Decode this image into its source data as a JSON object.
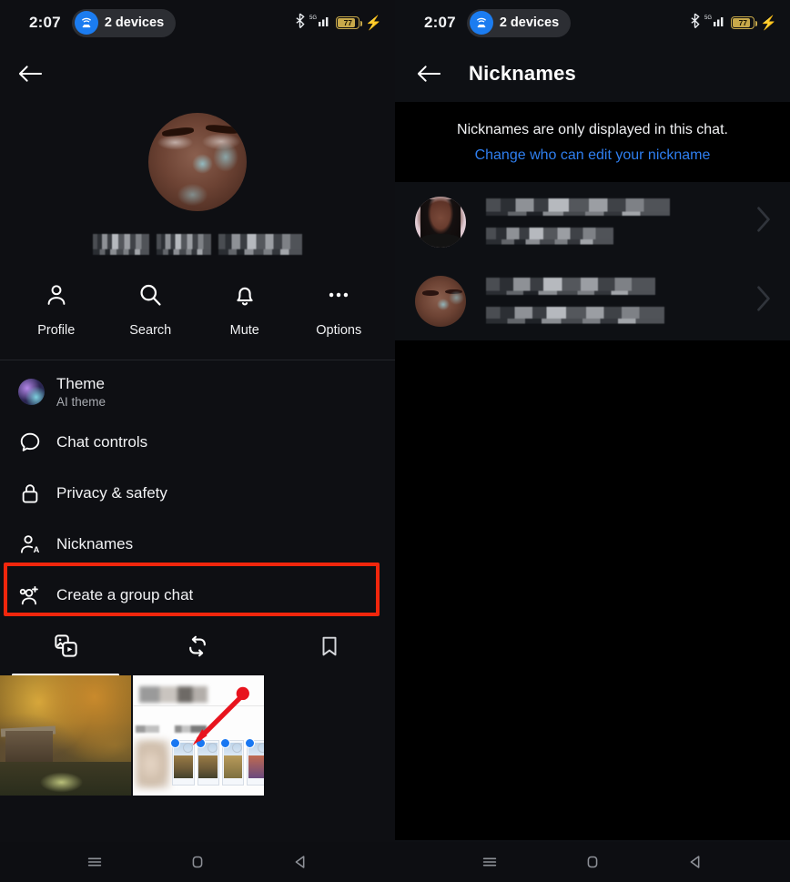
{
  "status_bar": {
    "time": "2:07",
    "devices_pill": {
      "label": "2 devices",
      "icon": "wifi-router-icon",
      "accent": "#1b7cf0"
    },
    "bluetooth_icon": "bluetooth-icon",
    "network": "5G",
    "signal_icon": "signal-bars-icon",
    "battery_percent": "77",
    "battery_charging_icon": "charging-bolt-icon",
    "battery_color": "#c8a94a"
  },
  "left_panel": {
    "back_icon": "back-arrow-icon",
    "profile": {
      "avatar": "profile-photo-avatar",
      "name_redacted": true,
      "name_segments": 3
    },
    "actions": [
      {
        "label": "Profile",
        "icon": "person-icon"
      },
      {
        "label": "Search",
        "icon": "search-icon"
      },
      {
        "label": "Mute",
        "icon": "bell-icon"
      },
      {
        "label": "Options",
        "icon": "more-horizontal-icon"
      }
    ],
    "menu": [
      {
        "title": "Theme",
        "subtitle": "AI theme",
        "icon": "theme-gradient-orb-icon"
      },
      {
        "title": "Chat controls",
        "subtitle": "",
        "icon": "chat-bubble-icon"
      },
      {
        "title": "Privacy & safety",
        "subtitle": "",
        "icon": "lock-icon"
      },
      {
        "title": "Nicknames",
        "subtitle": "",
        "icon": "person-with-a-icon",
        "highlighted": true
      },
      {
        "title": "Create a group chat",
        "subtitle": "",
        "icon": "add-people-icon"
      }
    ],
    "highlight_color": "#f1260c",
    "media_tabs": [
      {
        "icon": "photos-and-videos-icon",
        "active": true
      },
      {
        "icon": "shared-repeat-icon",
        "active": false
      },
      {
        "icon": "bookmark-icon",
        "active": false
      }
    ],
    "media_thumbnails": [
      {
        "name": "autumn-forest-cabin-photo"
      },
      {
        "name": "annotated-screenshot-with-red-arrow"
      }
    ]
  },
  "right_panel": {
    "back_icon": "back-arrow-icon",
    "title": "Nicknames",
    "info_text": "Nicknames are only displayed in this chat.",
    "info_link": "Change who can edit your nickname",
    "link_color": "#2f7ff0",
    "rows": [
      {
        "avatar": "contact-avatar-1",
        "name_redacted": true,
        "nickname_redacted": true,
        "chevron": "chevron-right-icon"
      },
      {
        "avatar": "contact-avatar-2",
        "name_redacted": true,
        "nickname_redacted": true,
        "chevron": "chevron-right-icon"
      }
    ]
  },
  "android_nav": [
    {
      "icon": "recents-menu-icon"
    },
    {
      "icon": "home-square-icon"
    },
    {
      "icon": "back-triangle-icon"
    }
  ]
}
